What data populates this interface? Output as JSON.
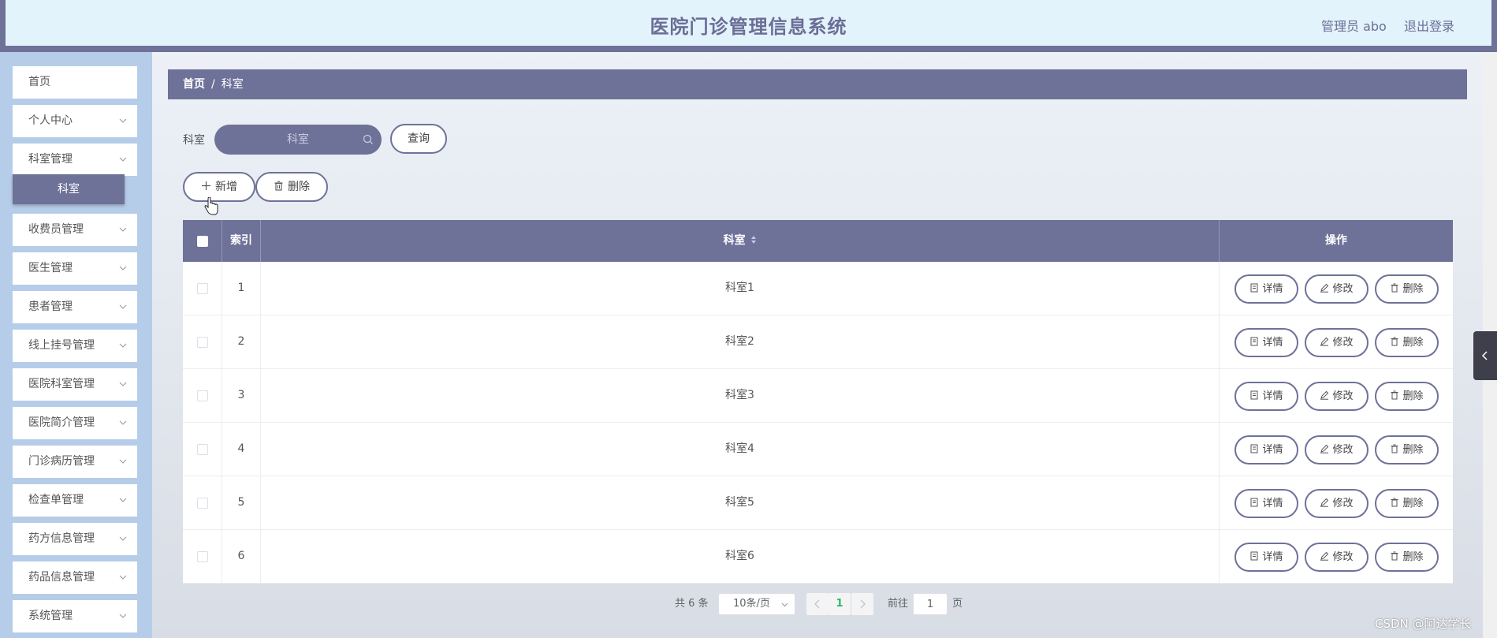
{
  "header": {
    "title": "医院门诊管理信息系统",
    "user": "管理员 abo",
    "logout": "退出登录"
  },
  "sidebar": {
    "items": [
      {
        "label": "首页",
        "has_arrow": false
      },
      {
        "label": "个人中心",
        "has_arrow": true
      },
      {
        "label": "科室管理",
        "has_arrow": true
      },
      {
        "label": "收费员管理",
        "has_arrow": true
      },
      {
        "label": "医生管理",
        "has_arrow": true
      },
      {
        "label": "患者管理",
        "has_arrow": true
      },
      {
        "label": "线上挂号管理",
        "has_arrow": true
      },
      {
        "label": "医院科室管理",
        "has_arrow": true
      },
      {
        "label": "医院简介管理",
        "has_arrow": true
      },
      {
        "label": "门诊病历管理",
        "has_arrow": true
      },
      {
        "label": "检查单管理",
        "has_arrow": true
      },
      {
        "label": "药方信息管理",
        "has_arrow": true
      },
      {
        "label": "药品信息管理",
        "has_arrow": true
      },
      {
        "label": "系统管理",
        "has_arrow": true
      }
    ],
    "active_submenu": "科室"
  },
  "breadcrumb": {
    "home": "首页",
    "separator": "/",
    "current": "科室"
  },
  "search": {
    "label": "科室",
    "placeholder": "科室",
    "query_button": "查询"
  },
  "toolbar": {
    "add_label": "新增",
    "delete_label": "删除"
  },
  "table": {
    "headers": {
      "index": "索引",
      "department": "科室",
      "operations": "操作"
    },
    "rows": [
      {
        "index": "1",
        "department": "科室1"
      },
      {
        "index": "2",
        "department": "科室2"
      },
      {
        "index": "3",
        "department": "科室3"
      },
      {
        "index": "4",
        "department": "科室4"
      },
      {
        "index": "5",
        "department": "科室5"
      },
      {
        "index": "6",
        "department": "科室6"
      }
    ],
    "row_actions": {
      "detail": "详情",
      "edit": "修改",
      "delete": "删除"
    }
  },
  "pagination": {
    "total": "共 6 条",
    "page_size": "10条/页",
    "current_page": "1",
    "goto_label": "前往",
    "goto_value": "1",
    "page_suffix": "页"
  },
  "watermark": "CSDN @阿达学长",
  "colors": {
    "accent": "#6e7198",
    "header_bg": "#e3f3fb",
    "sidebar_bg": "#b6cde9",
    "active_page": "#2bb673"
  },
  "icons": {
    "search": "search-icon",
    "plus": "plus-icon",
    "trash": "trash-icon",
    "document": "document-icon",
    "pencil": "pencil-icon",
    "chevron_down": "chevron-down-icon",
    "sort": "sort-icon"
  }
}
